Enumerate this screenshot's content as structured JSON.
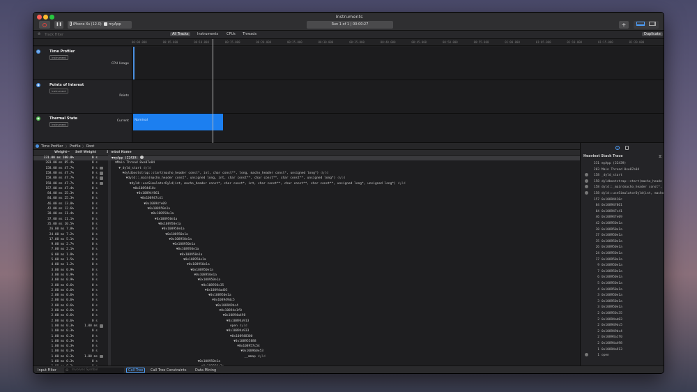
{
  "window": {
    "title": "Instruments",
    "device_label": "iPhone Xs (12.0)",
    "target_label": "myApp",
    "run_label": "Run 1 of 1  |  00:00:27",
    "add_label": "+",
    "duplicate_label": "Duplicate"
  },
  "filterbar": {
    "placeholder": "Track Filter",
    "tabs": [
      "All Tracks",
      "Instruments",
      "CPUs",
      "Threads"
    ]
  },
  "ruler": {
    "ticks": [
      "00:00.000",
      "00:05.000",
      "00:10.000",
      "00:15.000",
      "00:20.000",
      "00:25.000",
      "00:30.000",
      "00:35.000",
      "00:40.000",
      "00:45.000",
      "00:50.000",
      "00:55.000",
      "01:00.000",
      "01:05.000",
      "01:10.000",
      "01:15.000",
      "01:20.000"
    ]
  },
  "tracks": [
    {
      "name": "Time Profiler",
      "badge": "Instrument",
      "sub": "CPU Usage",
      "color": "#4a90e2"
    },
    {
      "name": "Points of Interest",
      "badge": "Instrument",
      "sub": "Points",
      "color": "#4a90e2"
    },
    {
      "name": "Thermal State",
      "badge": "Instrument",
      "sub": "Current",
      "color": "#58c25a",
      "bar_label": "Nominal",
      "bar_color": "#1c7ff0"
    }
  ],
  "breadcrumb": {
    "a": "Time Profiler",
    "b": "Profile",
    "c": "Root"
  },
  "columns": {
    "weight": "Weight~",
    "self": "Self Weight",
    "symbol": "Symbol Name"
  },
  "rows": [
    {
      "w": "331.00 ms",
      "p": "100.0%",
      "s": "0 s",
      "d": 0,
      "n": "▼myApp (22439)",
      "lib": "",
      "i": false,
      "sel": true
    },
    {
      "w": "283.00 ms",
      "p": "85.4%",
      "s": "0 s",
      "d": 1,
      "n": "▼Main Thread  0xe07e04",
      "lib": "",
      "i": false
    },
    {
      "w": "158.00 ms",
      "p": "47.7%",
      "s": "0 s",
      "d": 2,
      "n": "▼_dyld_start",
      "lib": "dyld",
      "i": true
    },
    {
      "w": "158.00 ms",
      "p": "47.7%",
      "s": "0 s",
      "d": 3,
      "n": "▼dyldbootstrap::start(macho_header const*, int, char const**, long, macho_header const*, unsigned long*)",
      "lib": "dyld",
      "i": true
    },
    {
      "w": "158.00 ms",
      "p": "47.7%",
      "s": "0 s",
      "d": 4,
      "n": "▼dyld::_main(macho_header const*, unsigned long, int, char const**, char const**, char const**, unsigned long*)",
      "lib": "dyld",
      "i": true
    },
    {
      "w": "158.00 ms",
      "p": "47.7%",
      "s": "0 s",
      "d": 5,
      "n": "▼dyld::useSimulatorDyld(int, macho_header const*, char const*, int, char const**, char const**, char const**, unsigned long*, unsigned long*)",
      "lib": "dyld",
      "i": true
    },
    {
      "w": "157.00 ms",
      "p": "47.4%",
      "s": "0 s",
      "d": 6,
      "n": "▼0x10894410c",
      "lib": "",
      "i": false
    },
    {
      "w": "84.00 ms",
      "p": "25.3%",
      "s": "0 s",
      "d": 7,
      "n": "▼0x10894f861",
      "lib": "",
      "i": false
    },
    {
      "w": "84.00 ms",
      "p": "25.3%",
      "s": "0 s",
      "d": 8,
      "n": "▼0x108947c41",
      "lib": "",
      "i": false
    },
    {
      "w": "46.00 ms",
      "p": "13.8%",
      "s": "0 s",
      "d": 9,
      "n": "▼0x10894fe09",
      "lib": "",
      "i": false
    },
    {
      "w": "42.00 ms",
      "p": "12.6%",
      "s": "0 s",
      "d": 10,
      "n": "▼0x108950e1a",
      "lib": "",
      "i": false
    },
    {
      "w": "38.00 ms",
      "p": "11.4%",
      "s": "0 s",
      "d": 11,
      "n": "▼0x108950e1a",
      "lib": "",
      "i": false
    },
    {
      "w": "37.00 ms",
      "p": "11.1%",
      "s": "0 s",
      "d": 12,
      "n": "▼0x108950e1a",
      "lib": "",
      "i": false
    },
    {
      "w": "35.00 ms",
      "p": "10.5%",
      "s": "0 s",
      "d": 13,
      "n": "▼0x108950e1a",
      "lib": "",
      "i": false
    },
    {
      "w": "26.00 ms",
      "p": "7.8%",
      "s": "0 s",
      "d": 14,
      "n": "▼0x108950e1a",
      "lib": "",
      "i": false
    },
    {
      "w": "24.00 ms",
      "p": "7.2%",
      "s": "0 s",
      "d": 15,
      "n": "▼0x108950e1a",
      "lib": "",
      "i": false
    },
    {
      "w": "17.00 ms",
      "p": "5.1%",
      "s": "0 s",
      "d": 16,
      "n": "▼0x108950e1a",
      "lib": "",
      "i": false
    },
    {
      "w": "9.00 ms",
      "p": "2.7%",
      "s": "0 s",
      "d": 17,
      "n": "▼0x108950e1a",
      "lib": "",
      "i": false
    },
    {
      "w": "7.00 ms",
      "p": "2.1%",
      "s": "0 s",
      "d": 18,
      "n": "▼0x108950e1a",
      "lib": "",
      "i": false
    },
    {
      "w": "6.00 ms",
      "p": "1.8%",
      "s": "0 s",
      "d": 19,
      "n": "▼0x108950e1a",
      "lib": "",
      "i": false
    },
    {
      "w": "5.00 ms",
      "p": "1.5%",
      "s": "0 s",
      "d": 20,
      "n": "▼0x108950e1a",
      "lib": "",
      "i": false
    },
    {
      "w": "4.00 ms",
      "p": "1.2%",
      "s": "0 s",
      "d": 21,
      "n": "▼0x108950e1a",
      "lib": "",
      "i": false
    },
    {
      "w": "3.00 ms",
      "p": "0.9%",
      "s": "0 s",
      "d": 22,
      "n": "▼0x108950e1a",
      "lib": "",
      "i": false
    },
    {
      "w": "3.00 ms",
      "p": "0.9%",
      "s": "0 s",
      "d": 23,
      "n": "▼0x108950e1a",
      "lib": "",
      "i": false
    },
    {
      "w": "3.00 ms",
      "p": "0.9%",
      "s": "0 s",
      "d": 24,
      "n": "▼0x108950e1a",
      "lib": "",
      "i": false
    },
    {
      "w": "2.00 ms",
      "p": "0.6%",
      "s": "0 s",
      "d": 25,
      "n": "▼0x108950c35",
      "lib": "",
      "i": false
    },
    {
      "w": "2.00 ms",
      "p": "0.6%",
      "s": "0 s",
      "d": 26,
      "n": "▼0x10894ad03",
      "lib": "",
      "i": false
    },
    {
      "w": "2.00 ms",
      "p": "0.6%",
      "s": "0 s",
      "d": 27,
      "n": "▼0x108950e1a",
      "lib": "",
      "i": false
    },
    {
      "w": "2.00 ms",
      "p": "0.6%",
      "s": "0 s",
      "d": 28,
      "n": "▼0x108949dc5",
      "lib": "",
      "i": false
    },
    {
      "w": "2.00 ms",
      "p": "0.6%",
      "s": "0 s",
      "d": 29,
      "n": "▼0x108949bc4",
      "lib": "",
      "i": false
    },
    {
      "w": "2.00 ms",
      "p": "0.6%",
      "s": "0 s",
      "d": 30,
      "n": "▼0x10894a1f0",
      "lib": "",
      "i": false
    },
    {
      "w": "2.00 ms",
      "p": "0.6%",
      "s": "0 s",
      "d": 31,
      "n": "▼0x10894a498",
      "lib": "",
      "i": false
    },
    {
      "w": "2.00 ms",
      "p": "0.6%",
      "s": "0 s",
      "d": 32,
      "n": "▼0x10894a913",
      "lib": "",
      "i": false
    },
    {
      "w": "1.00 ms",
      "p": "0.3%",
      "s": "1.00 ms",
      "d": 33,
      "n": "open",
      "lib": "dyld",
      "i": true
    },
    {
      "w": "1.00 ms",
      "p": "0.3%",
      "s": "0 s",
      "d": 32,
      "n": "▼0x10894a933",
      "lib": "",
      "i": false
    },
    {
      "w": "1.00 ms",
      "p": "0.3%",
      "s": "0 s",
      "d": 33,
      "n": "▼0x108948300",
      "lib": "",
      "i": false
    },
    {
      "w": "1.00 ms",
      "p": "0.3%",
      "s": "0 s",
      "d": 34,
      "n": "▼0x108955888",
      "lib": "",
      "i": false
    },
    {
      "w": "1.00 ms",
      "p": "0.3%",
      "s": "0 s",
      "d": 35,
      "n": "▼0x108957c54",
      "lib": "",
      "i": false
    },
    {
      "w": "1.00 ms",
      "p": "0.3%",
      "s": "0 s",
      "d": 36,
      "n": "▼0x108960e53",
      "lib": "",
      "i": false
    },
    {
      "w": "1.00 ms",
      "p": "0.3%",
      "s": "1.00 ms",
      "d": 37,
      "n": "__mmap",
      "lib": "dyld",
      "i": true
    },
    {
      "w": "1.00 ms",
      "p": "0.3%",
      "s": "0 s",
      "d": 24,
      "n": "▼0x108950e1a",
      "lib": "",
      "i": false
    },
    {
      "w": "1.00 ms",
      "p": "0.3%",
      "s": "0 s",
      "d": 25,
      "n": "▼0x108950e1a",
      "lib": "",
      "i": false
    }
  ],
  "heaviest": {
    "title": "Heaviest Stack Trace",
    "items": [
      {
        "c": "331",
        "n": "myApp (22439)",
        "i": false
      },
      {
        "c": "283",
        "n": "Main Thread  0xe07e04",
        "i": false
      },
      {
        "c": "158",
        "n": "_dyld_start",
        "i": true
      },
      {
        "c": "158",
        "n": "dyldbootstrap::start(macho_heade",
        "i": true
      },
      {
        "c": "158",
        "n": "dyld::_main(macho_header const*,",
        "i": true
      },
      {
        "c": "158",
        "n": "dyld::useSimulatorDyld(int, macho",
        "i": true
      },
      {
        "c": "157",
        "n": "0x10894410c",
        "i": false
      },
      {
        "c": "84",
        "n": "0x10894f861",
        "i": false
      },
      {
        "c": "84",
        "n": "0x108947c41",
        "i": false
      },
      {
        "c": "46",
        "n": "0x10894fe09",
        "i": false
      },
      {
        "c": "42",
        "n": "0x108950e1a",
        "i": false
      },
      {
        "c": "38",
        "n": "0x108950e1a",
        "i": false
      },
      {
        "c": "37",
        "n": "0x108950e1a",
        "i": false
      },
      {
        "c": "35",
        "n": "0x108950e1a",
        "i": false
      },
      {
        "c": "26",
        "n": "0x108950e1a",
        "i": false
      },
      {
        "c": "24",
        "n": "0x108950e1a",
        "i": false
      },
      {
        "c": "17",
        "n": "0x108950e1a",
        "i": false
      },
      {
        "c": "9",
        "n": "0x108950e1a",
        "i": false
      },
      {
        "c": "7",
        "n": "0x108950e1a",
        "i": false
      },
      {
        "c": "6",
        "n": "0x108950e1a",
        "i": false
      },
      {
        "c": "5",
        "n": "0x108950e1a",
        "i": false
      },
      {
        "c": "4",
        "n": "0x108950e1a",
        "i": false
      },
      {
        "c": "3",
        "n": "0x108950e1a",
        "i": false
      },
      {
        "c": "3",
        "n": "0x108950e1a",
        "i": false
      },
      {
        "c": "3",
        "n": "0x108950e1a",
        "i": false
      },
      {
        "c": "2",
        "n": "0x108950c35",
        "i": false
      },
      {
        "c": "2",
        "n": "0x10894ad03",
        "i": false
      },
      {
        "c": "2",
        "n": "0x108949dc5",
        "i": false
      },
      {
        "c": "2",
        "n": "0x108949bc4",
        "i": false
      },
      {
        "c": "2",
        "n": "0x10894a1f0",
        "i": false
      },
      {
        "c": "2",
        "n": "0x10894a498",
        "i": false
      },
      {
        "c": "1",
        "n": "0x10894a913",
        "i": false
      },
      {
        "c": "1",
        "n": "open",
        "i": true
      }
    ]
  },
  "footer": {
    "input_filter": "Input Filter",
    "involves_symbol": "Involves Symbol",
    "tabs": [
      "Call Tree",
      "Call Tree Constraints",
      "Data Mining"
    ]
  },
  "colors": {
    "accent": "#1c7ff0",
    "record": "#e0443e"
  }
}
